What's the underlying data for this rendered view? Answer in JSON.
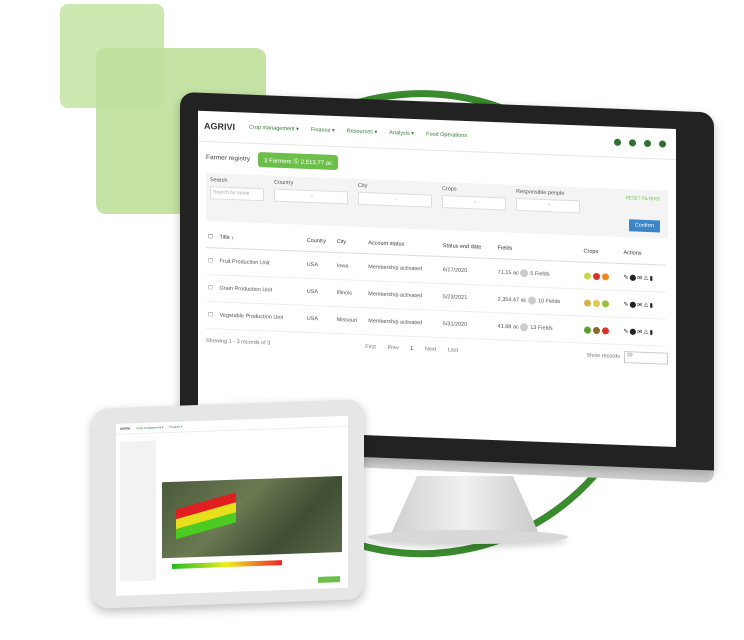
{
  "app": {
    "logo": "AGRIVI",
    "nav": [
      "Crop management ▾",
      "Finance ▾",
      "Resources ▾",
      "Analysis ▾",
      "Food Operations"
    ]
  },
  "header": {
    "title": "Farmer registry",
    "badge": "3 Farmers Ⓢ 2,513.77 ac"
  },
  "filters": {
    "search_label": "Search",
    "search_placeholder": "Search by name",
    "country_label": "Country",
    "country_value": "-",
    "city_label": "City",
    "city_value": "-",
    "crops_label": "Crops",
    "crops_value": "-",
    "people_label": "Responsible people",
    "people_value": "-",
    "reset_label": "RESET FILTERS",
    "confirm_label": "Confirm"
  },
  "table": {
    "headers": [
      "Title ↓",
      "Country",
      "City",
      "Account status",
      "Status end date",
      "Fields",
      "Crops",
      "Actions"
    ],
    "rows": [
      {
        "title": "Fruit Production Unit",
        "country": "USA",
        "city": "Iowa",
        "status": "Membership activated",
        "date": "6/17/2020",
        "area": "71.15",
        "unit": "ac",
        "fields": "5",
        "fields_label": "Fields",
        "actions": "✎⬤✉⚠▮"
      },
      {
        "title": "Grain Production Unit",
        "country": "USA",
        "city": "Illinois",
        "status": "Membership activated",
        "date": "5/23/2021",
        "area": "2,354.47",
        "unit": "ac",
        "fields": "10",
        "fields_label": "Fields",
        "actions": "✎⬤✉⚠▮"
      },
      {
        "title": "Vegetable Production Unit",
        "country": "USA",
        "city": "Missouri",
        "status": "Membership activated",
        "date": "5/31/2020",
        "area": "41.88",
        "unit": "ac",
        "fields": "13",
        "fields_label": "Fields",
        "actions": "✎⬤✉⚠▮"
      }
    ]
  },
  "pager": {
    "showing": "Showing 1 - 3 records of 3",
    "first": "First",
    "prev": "Prev",
    "page": "1",
    "next": "Next",
    "last": "Last",
    "show_label": "Show records",
    "show_value": "20"
  },
  "colors": {
    "brand": "#6cc04a",
    "arc": "#3a8a2e",
    "confirm": "#3a86c8"
  },
  "icons": [
    "help-icon",
    "calendar-icon",
    "bell-icon",
    "user-icon",
    "sort-arrow-icon",
    "edit-icon",
    "delete-icon"
  ]
}
